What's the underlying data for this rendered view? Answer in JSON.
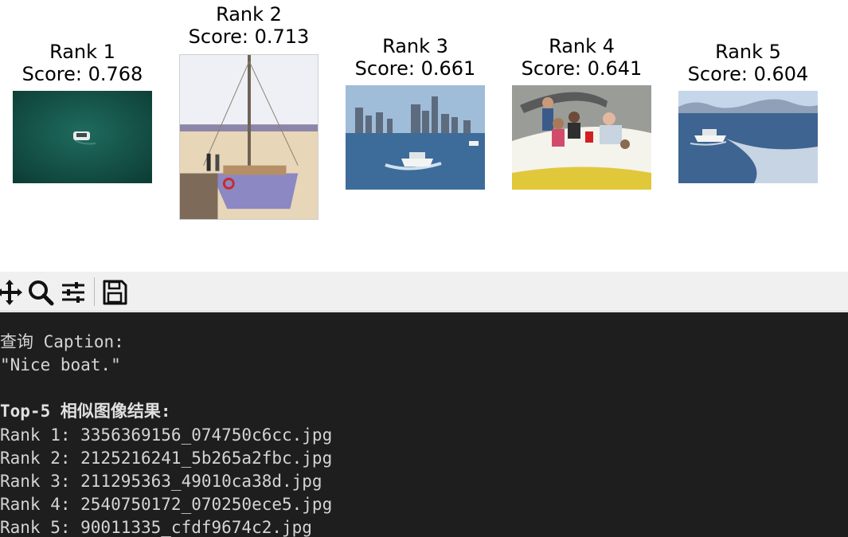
{
  "results": [
    {
      "title": "Rank 1",
      "score": "Score: 0.768",
      "image": "green-water-boat-image"
    },
    {
      "title": "Rank 2",
      "score": "Score: 0.713",
      "image": "sailboat-dock-image"
    },
    {
      "title": "Rank 3",
      "score": "Score: 0.661",
      "image": "yacht-city-skyline-image"
    },
    {
      "title": "Rank 4",
      "score": "Score: 0.641",
      "image": "people-on-speedboat-image"
    },
    {
      "title": "Rank 5",
      "score": "Score: 0.604",
      "image": "motorboat-wake-image"
    }
  ],
  "toolbar": {
    "icons": [
      "move-arrows-icon",
      "magnifier-icon",
      "sliders-icon",
      "floppy-disk-icon"
    ]
  },
  "console": {
    "query_header": "查询 Caption:",
    "query_text": "\"Nice boat.\"",
    "results_header": "Top-5 相似图像结果:",
    "lines": [
      "Rank 1: 3356369156_074750c6cc.jpg",
      "Rank 2: 2125216241_5b265a2fbc.jpg",
      "Rank 3: 211295363_49010ca38d.jpg",
      "Rank 4: 2540750172_070250ece5.jpg",
      "Rank 5: 90011335_cfdf9674c2.jpg"
    ]
  },
  "colors": {
    "console_bg": "#1e1e1e",
    "console_text": "#d4d4d4",
    "toolbar_bg": "#f0f0f0"
  }
}
